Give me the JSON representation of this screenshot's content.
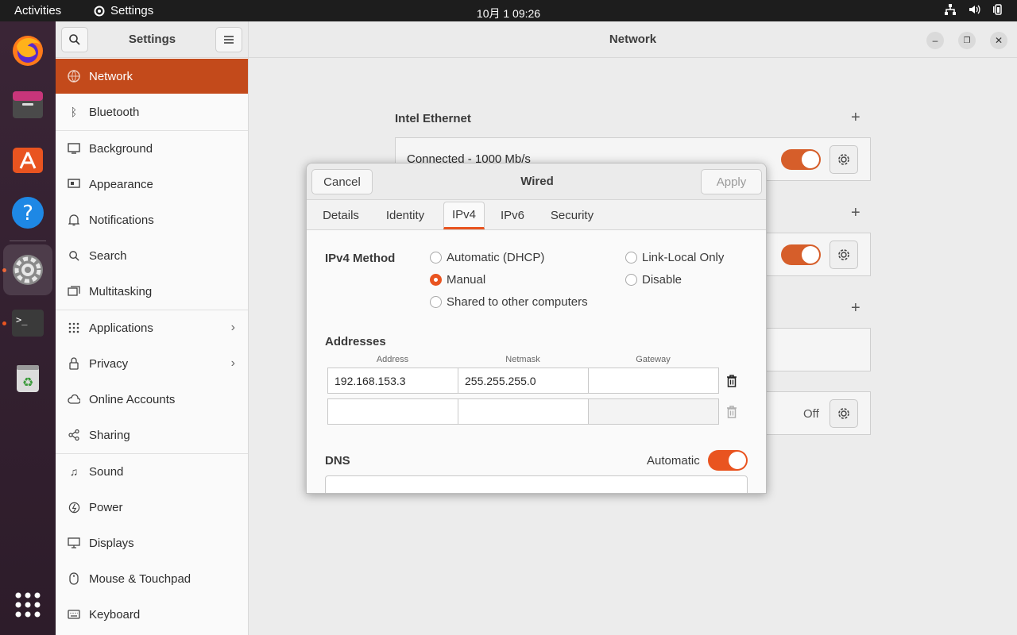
{
  "topbar": {
    "activities": "Activities",
    "app_name": "Settings",
    "clock": "10月 1  09:26"
  },
  "sidebar": {
    "title": "Settings",
    "items": [
      {
        "label": "Network",
        "icon": "network-icon"
      },
      {
        "label": "Bluetooth",
        "icon": "bluetooth-icon"
      },
      {
        "label": "Background",
        "icon": "background-icon"
      },
      {
        "label": "Appearance",
        "icon": "appearance-icon"
      },
      {
        "label": "Notifications",
        "icon": "bell-icon"
      },
      {
        "label": "Search",
        "icon": "search-icon"
      },
      {
        "label": "Multitasking",
        "icon": "multitasking-icon"
      },
      {
        "label": "Applications",
        "icon": "grid-icon"
      },
      {
        "label": "Privacy",
        "icon": "lock-icon"
      },
      {
        "label": "Online Accounts",
        "icon": "cloud-icon"
      },
      {
        "label": "Sharing",
        "icon": "share-icon"
      },
      {
        "label": "Sound",
        "icon": "music-note-icon"
      },
      {
        "label": "Power",
        "icon": "power-icon"
      },
      {
        "label": "Displays",
        "icon": "display-icon"
      },
      {
        "label": "Mouse & Touchpad",
        "icon": "mouse-icon"
      },
      {
        "label": "Keyboard",
        "icon": "keyboard-icon"
      }
    ]
  },
  "main": {
    "title": "Network",
    "section_ethernet": "Intel Ethernet",
    "ethernet_status": "Connected - 1000 Mb/s",
    "proxy_status": "Off"
  },
  "dialog": {
    "title": "Wired",
    "cancel": "Cancel",
    "apply": "Apply",
    "tabs": [
      "Details",
      "Identity",
      "IPv4",
      "IPv6",
      "Security"
    ],
    "ipv4_method_label": "IPv4 Method",
    "methods": {
      "auto": "Automatic (DHCP)",
      "manual": "Manual",
      "shared": "Shared to other computers",
      "linklocal": "Link-Local Only",
      "disable": "Disable"
    },
    "addresses_label": "Addresses",
    "col_address": "Address",
    "col_netmask": "Netmask",
    "col_gateway": "Gateway",
    "row1": {
      "address": "192.168.153.3",
      "netmask": "255.255.255.0",
      "gateway": ""
    },
    "dns_label": "DNS",
    "dns_automatic": "Automatic"
  },
  "colors": {
    "accent": "#e95420",
    "sidebar_selected": "#c34a1b"
  }
}
